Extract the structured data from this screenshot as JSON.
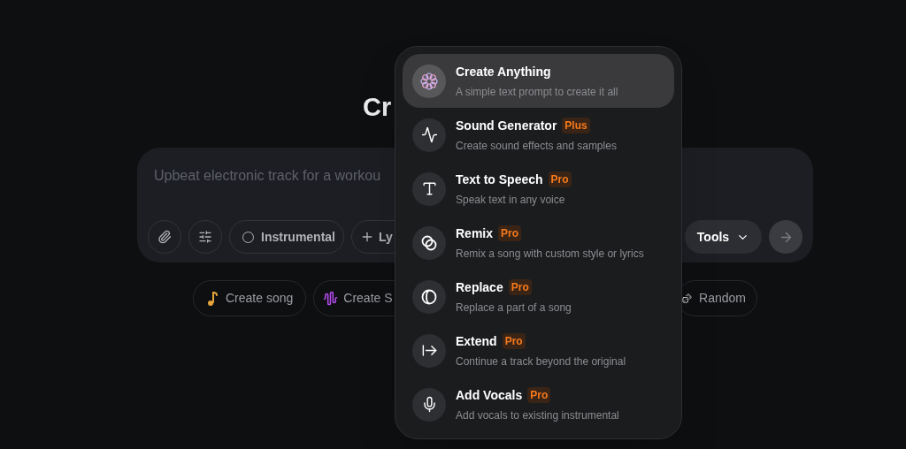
{
  "heading": "Cr",
  "prompt": {
    "placeholder": "Upbeat electronic track for a workou"
  },
  "toolbar": {
    "instrumental": {
      "label": "Instrumental",
      "selected": false
    },
    "lyrics": {
      "label": "Ly"
    },
    "tools": {
      "label": "Tools"
    }
  },
  "suggestions": [
    {
      "kind": "song",
      "label": "Create song"
    },
    {
      "kind": "sound",
      "label": "Create S"
    },
    {
      "kind": "random",
      "label": "Random"
    }
  ],
  "menu": {
    "items": [
      {
        "kind": "anything",
        "title": "Create Anything",
        "description": "A simple text prompt to create it all",
        "selected": true
      },
      {
        "kind": "sound",
        "title": "Sound Generator",
        "badge": "Plus",
        "description": "Create sound effects and samples",
        "selected": false
      },
      {
        "kind": "speech",
        "title": "Text to Speech",
        "badge": "Pro",
        "description": "Speak text in any voice",
        "selected": false
      },
      {
        "kind": "remix",
        "title": "Remix",
        "badge": "Pro",
        "description": "Remix a song with custom style or lyrics",
        "selected": false
      },
      {
        "kind": "replace",
        "title": "Replace",
        "badge": "Pro",
        "description": "Replace a part of a song",
        "selected": false
      },
      {
        "kind": "extend",
        "title": "Extend",
        "badge": "Pro",
        "description": "Continue a track beyond the original",
        "selected": false
      },
      {
        "kind": "vocals",
        "title": "Add Vocals",
        "badge": "Pro",
        "description": "Add vocals to existing instrumental",
        "selected": false
      }
    ]
  }
}
